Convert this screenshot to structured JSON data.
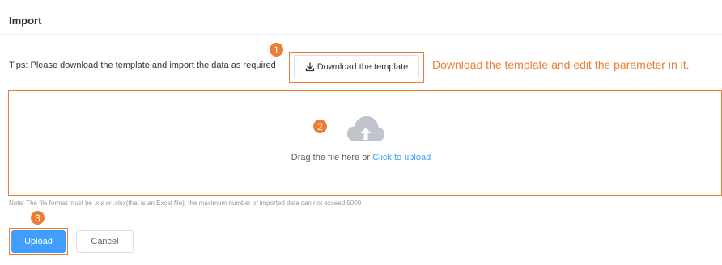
{
  "dialog": {
    "title": "Import"
  },
  "tips": {
    "text": "Tips: Please download the template and import the data as required"
  },
  "download": {
    "label": "Download the template",
    "icon": "download-icon"
  },
  "annotations": {
    "step1": "1",
    "step2": "2",
    "step3": "3",
    "download_note": "Download the template and edit the parameter in it."
  },
  "upload_area": {
    "icon": "cloud-upload-icon",
    "prompt": "Drag the file here or ",
    "link": "Click to upload"
  },
  "format_note": "Note: The file format must be .xls or .xlsx(that is an Excel file), the maximum number of imported data can not exceed 5000",
  "actions": {
    "upload_label": "Upload",
    "cancel_label": "Cancel"
  },
  "colors": {
    "accent": "#409eff",
    "annotation": "#ed7d31",
    "icon_gray": "#c0c4cc"
  }
}
